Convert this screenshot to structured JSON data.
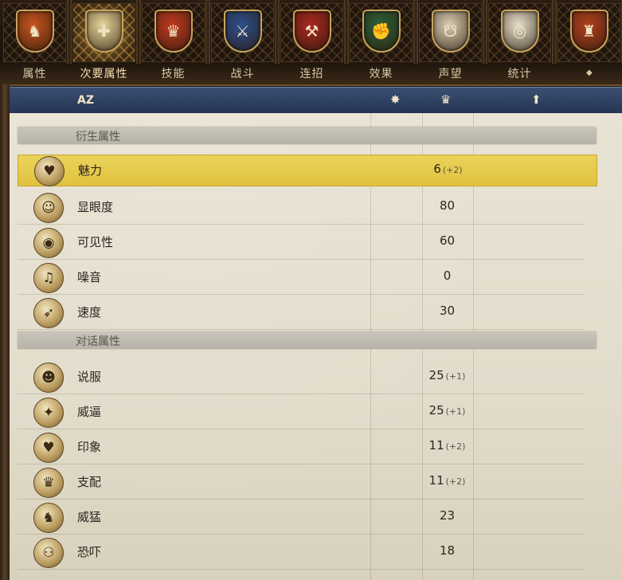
{
  "tabs": [
    {
      "label": "属性",
      "icon": "knight-shield-icon",
      "glyph": "♞",
      "color": "#c8541c"
    },
    {
      "label": "次要属性",
      "icon": "cross-flowers-shield-icon",
      "glyph": "✚",
      "color": "#e8d79a",
      "active": true
    },
    {
      "label": "技能",
      "icon": "lion-shield-icon",
      "glyph": "♛",
      "color": "#c0391f"
    },
    {
      "label": "战斗",
      "icon": "sword-shield-icon",
      "glyph": "⚔",
      "color": "#2c4f8e"
    },
    {
      "label": "连招",
      "icon": "axe-shield-icon",
      "glyph": "⚒",
      "color": "#a8281f"
    },
    {
      "label": "效果",
      "icon": "fist-shield-icon",
      "glyph": "✊",
      "color": "#2d6038"
    },
    {
      "label": "声望",
      "icon": "noose-shield-icon",
      "glyph": "☋",
      "color": "#d9cfb4"
    },
    {
      "label": "统计",
      "icon": "target-shield-icon",
      "glyph": "◎",
      "color": "#e9e0cc"
    },
    {
      "label": "",
      "icon": "helmet-shield-icon",
      "glyph": "♜",
      "color": "#b2401e"
    }
  ],
  "header": {
    "sort_label": "AZ",
    "icons": [
      "star-icon",
      "crown-icon",
      "arrow-up-icon"
    ],
    "star": "✸",
    "crown": "♛",
    "arrow": "⬆",
    "dropdown": "◆"
  },
  "sections": [
    {
      "title": "衍生属性",
      "rows": [
        {
          "name": "魅力",
          "value": "6",
          "mod": "(+2)",
          "icon": "charm-icon",
          "glyph": "♥",
          "selected": true
        },
        {
          "name": "显眼度",
          "value": "80",
          "mod": "",
          "icon": "jester-icon",
          "glyph": "☺"
        },
        {
          "name": "可见性",
          "value": "60",
          "mod": "",
          "icon": "visibility-icon",
          "glyph": "◉"
        },
        {
          "name": "噪音",
          "value": "0",
          "mod": "",
          "icon": "noise-icon",
          "glyph": "♫"
        },
        {
          "name": "速度",
          "value": "30",
          "mod": "",
          "icon": "speed-icon",
          "glyph": "➶"
        }
      ]
    },
    {
      "title": "对话属性",
      "rows": [
        {
          "name": "说服",
          "value": "25",
          "mod": "(+1)",
          "icon": "persuasion-icon",
          "glyph": "☻"
        },
        {
          "name": "威逼",
          "value": "25",
          "mod": "(+1)",
          "icon": "coercion-icon",
          "glyph": "✦"
        },
        {
          "name": "印象",
          "value": "11",
          "mod": "(+2)",
          "icon": "impress-icon",
          "glyph": "♥"
        },
        {
          "name": "支配",
          "value": "11",
          "mod": "(+2)",
          "icon": "dominance-icon",
          "glyph": "♛"
        },
        {
          "name": "威猛",
          "value": "23",
          "mod": "",
          "icon": "intimidation-icon",
          "glyph": "♞"
        },
        {
          "name": "恐吓",
          "value": "18",
          "mod": "",
          "icon": "threaten-icon",
          "glyph": "⚇"
        }
      ]
    }
  ]
}
